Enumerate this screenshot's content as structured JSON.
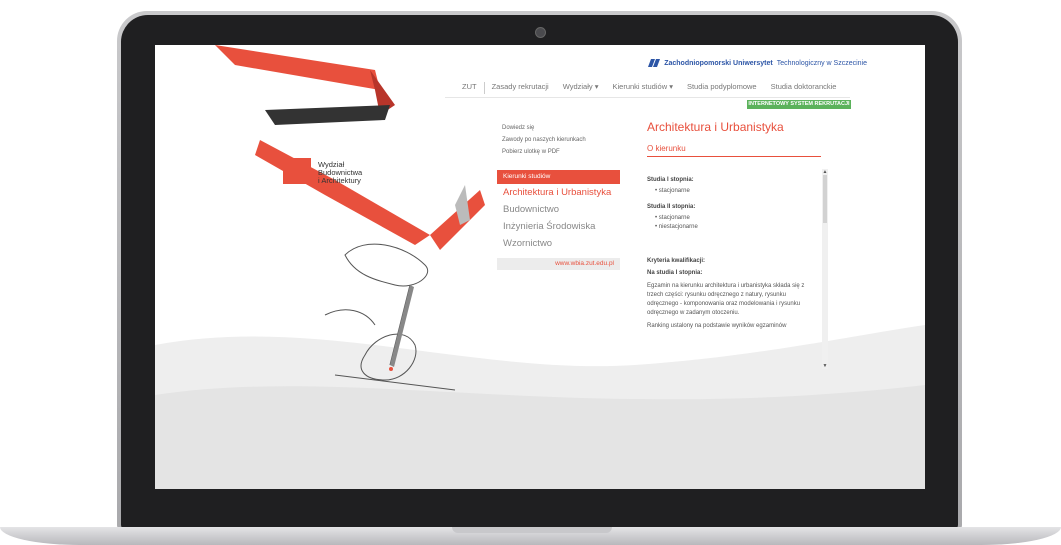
{
  "header": {
    "university_bold": "Zachodniopomorski Uniwersytet",
    "university_rest": "Technologiczny w Szczecinie"
  },
  "nav": {
    "items": [
      {
        "label": "ZUT"
      },
      {
        "label": "Zasady rekrutacji"
      },
      {
        "label": "Wydziały ▾"
      },
      {
        "label": "Kierunki studiów ▾"
      },
      {
        "label": "Studia podyplomowe"
      },
      {
        "label": "Studia doktoranckie"
      }
    ],
    "button_label": "INTERNETOWY SYSTEM REKRUTACJI"
  },
  "brand": {
    "line1": "Wydział",
    "line2": "Budownictwa",
    "line3": "i Architektury"
  },
  "left_links": {
    "items": [
      "Dowiedz się",
      "Zawody po naszych kierunkach",
      "Pobierz ulotkę w PDF"
    ]
  },
  "menu": {
    "header": "Kierunki studiów",
    "items": [
      {
        "label": "Architektura i Urbanistyka"
      },
      {
        "label": "Budownictwo"
      },
      {
        "label": "Inżynieria Środowiska"
      },
      {
        "label": "Wzornictwo"
      }
    ],
    "www": "www.wbia.zut.edu.pl"
  },
  "content": {
    "title": "Architektura i Urbanistyka",
    "subtitle": "O kierunku",
    "s1_head": "Studia I stopnia:",
    "s1_items": [
      "stacjonarne"
    ],
    "s2_head": "Studia II stopnia:",
    "s2_items": [
      "stacjonarne",
      "niestacjonarne"
    ],
    "criteria_head": "Kryteria kwalifikacji:",
    "criteria_sub": "Na studia I stopnia:",
    "criteria_text": "Egzamin na kierunku architektura i urbanistyka składa się z trzech części: rysunku odręcznego z natury, rysunku odręcznego - komponowania oraz modelowania i rysunku odręcznego w zadanym otoczeniu.",
    "ranking_text": "Ranking ustalony na podstawie wyników egzaminów"
  },
  "colors": {
    "accent": "#e8503d",
    "green": "#5bb25b",
    "blue": "#2c55a6"
  }
}
